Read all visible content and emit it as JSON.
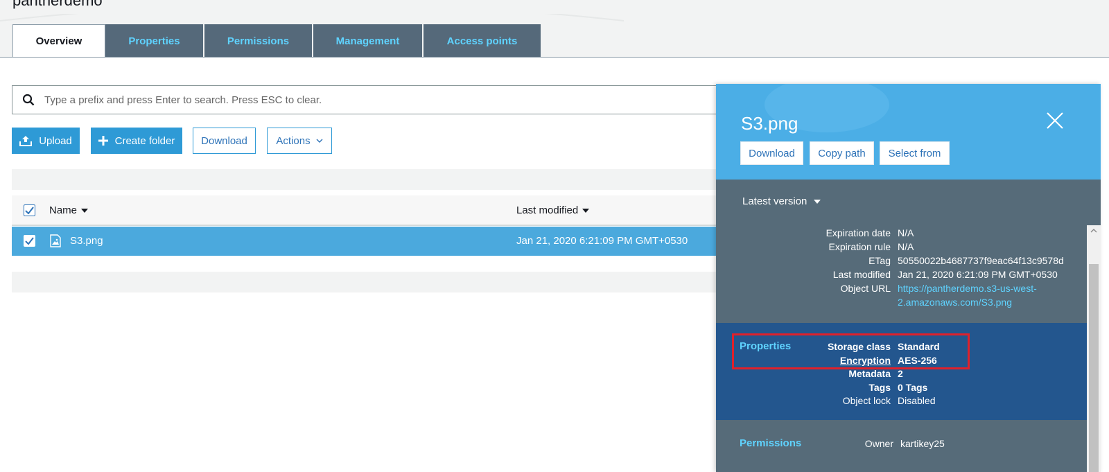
{
  "bucket": {
    "title": "pantherdemo"
  },
  "tabs": [
    {
      "label": "Overview",
      "active": true
    },
    {
      "label": "Properties"
    },
    {
      "label": "Permissions"
    },
    {
      "label": "Management"
    },
    {
      "label": "Access points"
    }
  ],
  "search": {
    "placeholder": "Type a prefix and press Enter to search. Press ESC to clear.",
    "icon": "search-icon"
  },
  "toolbar": {
    "upload": "Upload",
    "create_folder": "Create folder",
    "download": "Download",
    "actions": "Actions"
  },
  "table": {
    "columns": {
      "name": "Name",
      "last_modified": "Last modified"
    },
    "rows": [
      {
        "name": "S3.png",
        "last_modified": "Jan 21, 2020 6:21:09 PM GMT+0530",
        "selected": true
      }
    ]
  },
  "panel": {
    "title": "S3.png",
    "buttons": {
      "download": "Download",
      "copy_path": "Copy path",
      "select_from": "Select from"
    },
    "version": "Latest version",
    "overview": [
      {
        "label": "Expiration date",
        "value": "N/A"
      },
      {
        "label": "Expiration rule",
        "value": "N/A"
      },
      {
        "label": "ETag",
        "value": "50550022b4687737f9eac64f13c9578d"
      },
      {
        "label": "Last modified",
        "value": "Jan 21, 2020 6:21:09 PM GMT+0530"
      },
      {
        "label": "Object URL",
        "value": "https://pantherdemo.s3-us-west-",
        "value2": "2.amazonaws.com/S3.png"
      }
    ],
    "properties": {
      "title": "Properties",
      "items": [
        {
          "label": "Storage class",
          "value": "Standard"
        },
        {
          "label": "Encryption",
          "value": "AES-256"
        },
        {
          "label": "Metadata",
          "value": "2"
        },
        {
          "label": "Tags",
          "value": "0 Tags"
        },
        {
          "label": "Object lock",
          "value": "Disabled"
        }
      ]
    },
    "permissions": {
      "title": "Permissions",
      "items": [
        {
          "label": "Owner",
          "value": "kartikey25"
        }
      ]
    }
  },
  "colors": {
    "accent": "#2e9ad6",
    "tab_bg": "#55697a",
    "tab_text": "#5fd3ff",
    "selected_row": "#4ba9dd",
    "highlight": "#e0212b"
  }
}
